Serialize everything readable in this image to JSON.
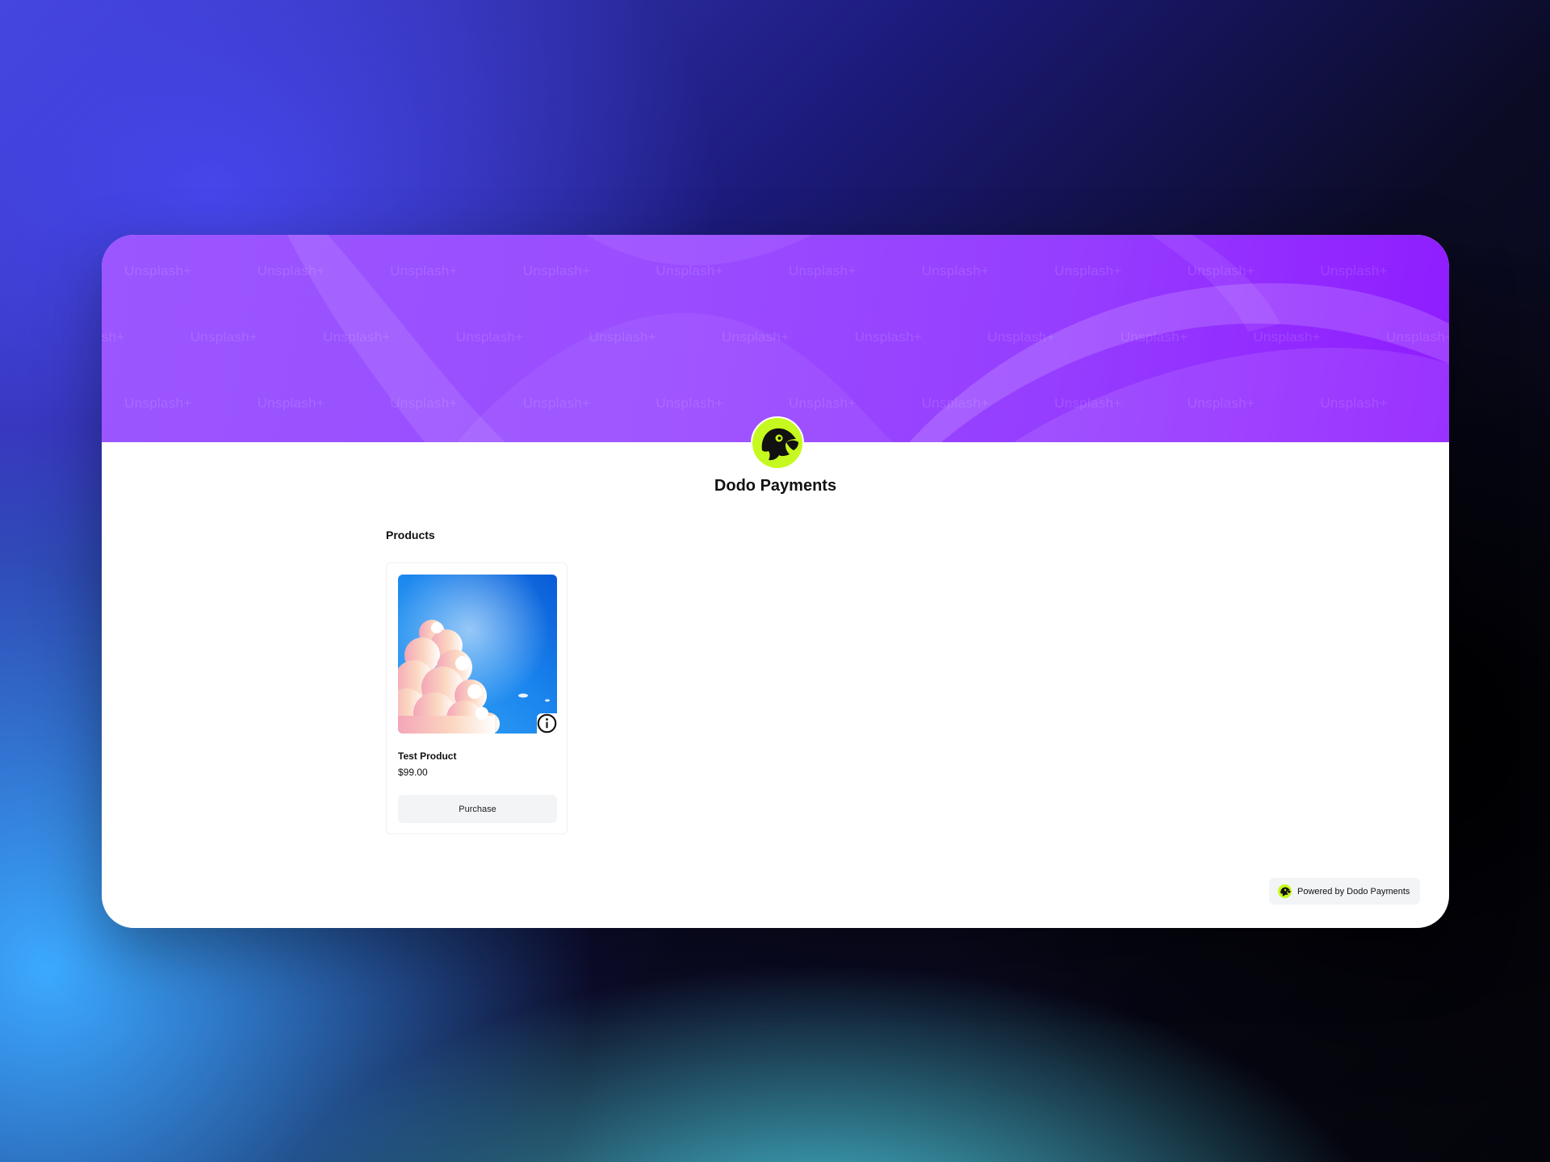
{
  "store": {
    "name": "Dodo Payments",
    "logo_icon": "dodo-bird-logo",
    "logo_color": "#c6f91f"
  },
  "banner": {
    "watermark_text": "Unsplash+",
    "colors": [
      "#9b56ff",
      "#8f1bff"
    ]
  },
  "products_section": {
    "title": "Products",
    "items": [
      {
        "name": "Test Product",
        "price": "$99.00",
        "image": "sky-with-clouds",
        "info_icon": "info-icon",
        "button_label": "Purchase"
      }
    ]
  },
  "footer": {
    "powered_by": "Powered by Dodo Payments"
  }
}
